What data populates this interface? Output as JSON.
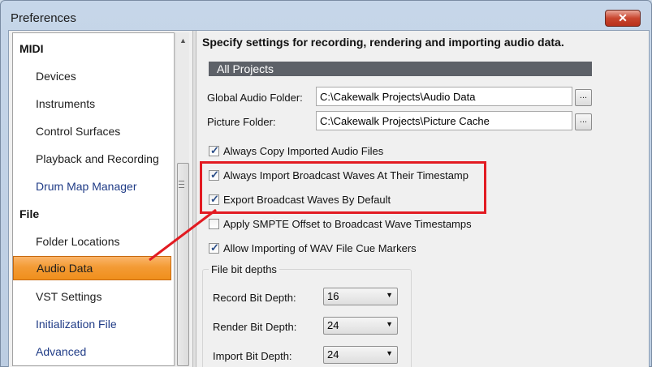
{
  "window": {
    "title": "Preferences",
    "close_glyph": "✕"
  },
  "nav": {
    "groups": [
      {
        "label": "MIDI",
        "items": [
          {
            "label": "Devices",
            "link": false
          },
          {
            "label": "Instruments",
            "link": false
          },
          {
            "label": "Control Surfaces",
            "link": false
          },
          {
            "label": "Playback and Recording",
            "link": false
          },
          {
            "label": "Drum Map Manager",
            "link": true
          }
        ]
      },
      {
        "label": "File",
        "items": [
          {
            "label": "Folder Locations",
            "link": false
          },
          {
            "label": "Audio Data",
            "link": false,
            "selected": true
          },
          {
            "label": "VST Settings",
            "link": false
          },
          {
            "label": "Initialization File",
            "link": true
          },
          {
            "label": "Advanced",
            "link": true
          }
        ]
      }
    ]
  },
  "panel": {
    "heading": "Specify settings for recording, rendering and importing audio data.",
    "section": "All Projects",
    "global_audio_folder": {
      "label": "Global Audio Folder:",
      "value": "C:\\Cakewalk Projects\\Audio Data"
    },
    "picture_folder": {
      "label": "Picture Folder:",
      "value": "C:\\Cakewalk Projects\\Picture Cache"
    },
    "browse_label": "...",
    "checkboxes": [
      {
        "label": "Always Copy Imported Audio Files",
        "checked": true
      },
      {
        "label": "Always Import Broadcast Waves At Their Timestamp",
        "checked": true
      },
      {
        "label": "Export Broadcast Waves By Default",
        "checked": true
      },
      {
        "label": "Apply SMPTE Offset to Broadcast Wave Timestamps",
        "checked": false
      },
      {
        "label": "Allow Importing of WAV File Cue Markers",
        "checked": true
      }
    ],
    "bit_depths": {
      "title": "File bit depths",
      "record": {
        "label": "Record Bit Depth:",
        "value": "16"
      },
      "render": {
        "label": "Render Bit Depth:",
        "value": "24"
      },
      "import": {
        "label": "Import Bit Depth:",
        "value": "24"
      }
    }
  },
  "annotation": {
    "color": "#e21b22"
  }
}
